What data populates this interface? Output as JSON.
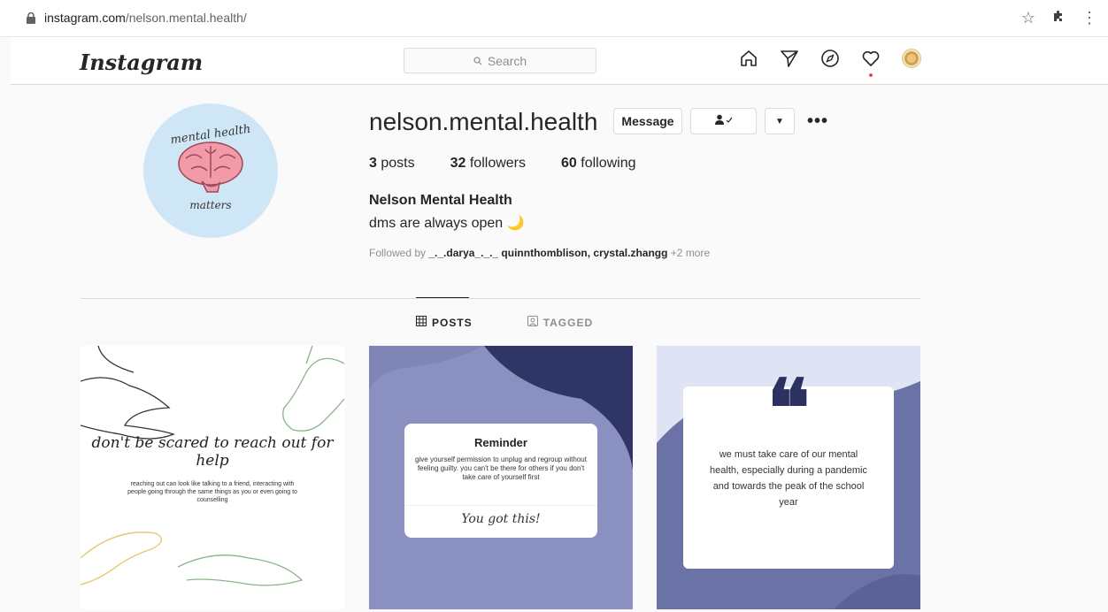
{
  "browser": {
    "url_host": "instagram.com",
    "url_path": "/nelson.mental.health/"
  },
  "header": {
    "logo": "Instagram",
    "search_placeholder": "Search",
    "icons": [
      "home-icon",
      "direct-message-icon",
      "explore-icon",
      "activity-heart-icon",
      "profile-avatar"
    ]
  },
  "profile": {
    "username": "nelson.mental.health",
    "message_label": "Message",
    "stats": {
      "posts_count": "3",
      "posts_label": "posts",
      "followers_count": "32",
      "followers_label": "followers",
      "following_count": "60",
      "following_label": "following"
    },
    "full_name": "Nelson Mental Health",
    "bio": "dms are always open 🌙",
    "followed_prefix": "Followed by",
    "followed_users": "_._.darya_._._ quinnthomblison, crystal.zhangg",
    "followed_more": "+2 more",
    "picture_text_top": "mental health",
    "picture_text_bottom": "matters"
  },
  "tabs": [
    {
      "label": "POSTS",
      "active": true
    },
    {
      "label": "TAGGED",
      "active": false
    }
  ],
  "posts": [
    {
      "title": "don't be scared to reach out for help",
      "body": "reaching out can look like talking to a friend, interacting with people going through the same things as you or even going to counselling"
    },
    {
      "title": "Reminder",
      "body": "give yourself permission to unplug and regroup without feeling guilty. you can't be there for others if you don't take care of yourself first",
      "sign": "You got this!"
    },
    {
      "quote": "❝",
      "body": "we must take care of our mental health, especially during a pandemic and towards the peak of the school year"
    }
  ],
  "colors": {
    "accent_dark_navy": "#2b3160",
    "periwinkle": "#8a90bf",
    "notification_dot": "#ed4956"
  }
}
